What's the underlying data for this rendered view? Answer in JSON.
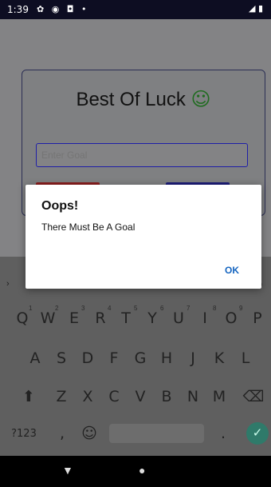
{
  "statusbar": {
    "time": "1:39",
    "icons": "✿ ◉ ◘ •",
    "right_icons": "◢ ▮"
  },
  "app": {
    "title": "Best Of Luck",
    "title_emoji": "☺",
    "goal_input_placeholder": "Enter Goal"
  },
  "dialog": {
    "title": "Oops!",
    "message": "There Must Be A Goal",
    "ok_label": "OK"
  },
  "keyboard": {
    "row1": [
      "Q",
      "W",
      "E",
      "R",
      "T",
      "Y",
      "U",
      "I",
      "O",
      "P"
    ],
    "row1_numbers": [
      "1",
      "2",
      "3",
      "4",
      "5",
      "6",
      "7",
      "8",
      "9"
    ],
    "row2": [
      "A",
      "S",
      "D",
      "F",
      "G",
      "H",
      "J",
      "K",
      "L"
    ],
    "row3": [
      "Z",
      "X",
      "C",
      "V",
      "B",
      "N",
      "M"
    ],
    "shift": "⬆",
    "backspace": "⌫",
    "symbols": "?123",
    "comma": ",",
    "emoji": "☺",
    "period": ".",
    "enter": "✓",
    "suggest_arrow": "›",
    "mic": "🎙"
  },
  "navbar": {
    "back": "▼",
    "home": "●"
  }
}
